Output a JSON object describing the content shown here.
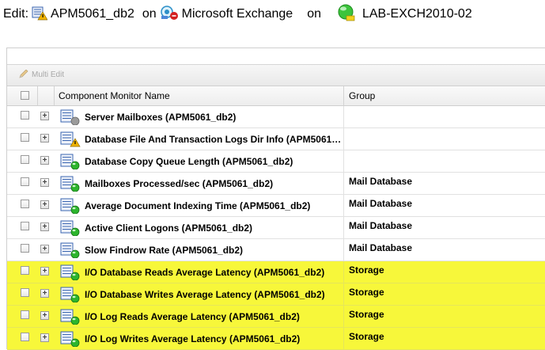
{
  "header": {
    "edit_label": "Edit:",
    "app_name": "APM5061_db2",
    "on1": "on",
    "template": "Microsoft Exchange",
    "on2": "on",
    "node": "LAB-EXCH2010-02"
  },
  "toolbar": {
    "multi_edit": "Multi Edit"
  },
  "columns": {
    "name": "Component Monitor Name",
    "group": "Group"
  },
  "rows": [
    {
      "name": "Server Mailboxes (APM5061_db2)",
      "group": "",
      "status": "unknown",
      "highlight": false
    },
    {
      "name": "Database File And Transaction Logs Dir Info (APM5061…",
      "group": "",
      "status": "warning",
      "highlight": false
    },
    {
      "name": "Database Copy Queue Length (APM5061_db2)",
      "group": "",
      "status": "up",
      "highlight": false
    },
    {
      "name": "Mailboxes Processed/sec (APM5061_db2)",
      "group": "Mail Database",
      "status": "up",
      "highlight": false
    },
    {
      "name": "Average Document Indexing Time (APM5061_db2)",
      "group": "Mail Database",
      "status": "up",
      "highlight": false
    },
    {
      "name": "Active Client Logons (APM5061_db2)",
      "group": "Mail Database",
      "status": "up",
      "highlight": false
    },
    {
      "name": "Slow Findrow Rate (APM5061_db2)",
      "group": "Mail Database",
      "status": "up",
      "highlight": false
    },
    {
      "name": "I/O Database Reads Average Latency (APM5061_db2)",
      "group": "Storage",
      "status": "up",
      "highlight": true
    },
    {
      "name": "I/O Database Writes Average Latency (APM5061_db2)",
      "group": "Storage",
      "status": "up",
      "highlight": true
    },
    {
      "name": "I/O Log Reads Average Latency (APM5061_db2)",
      "group": "Storage",
      "status": "up",
      "highlight": true
    },
    {
      "name": "I/O Log Writes Average Latency (APM5061_db2)",
      "group": "Storage",
      "status": "up",
      "highlight": true
    }
  ],
  "colors": {
    "highlight": "#f7f73a",
    "status_up": "#2db52d",
    "status_warning": "#f2b400",
    "status_unknown": "#9b9b9b",
    "node_green": "#3cc43c"
  }
}
